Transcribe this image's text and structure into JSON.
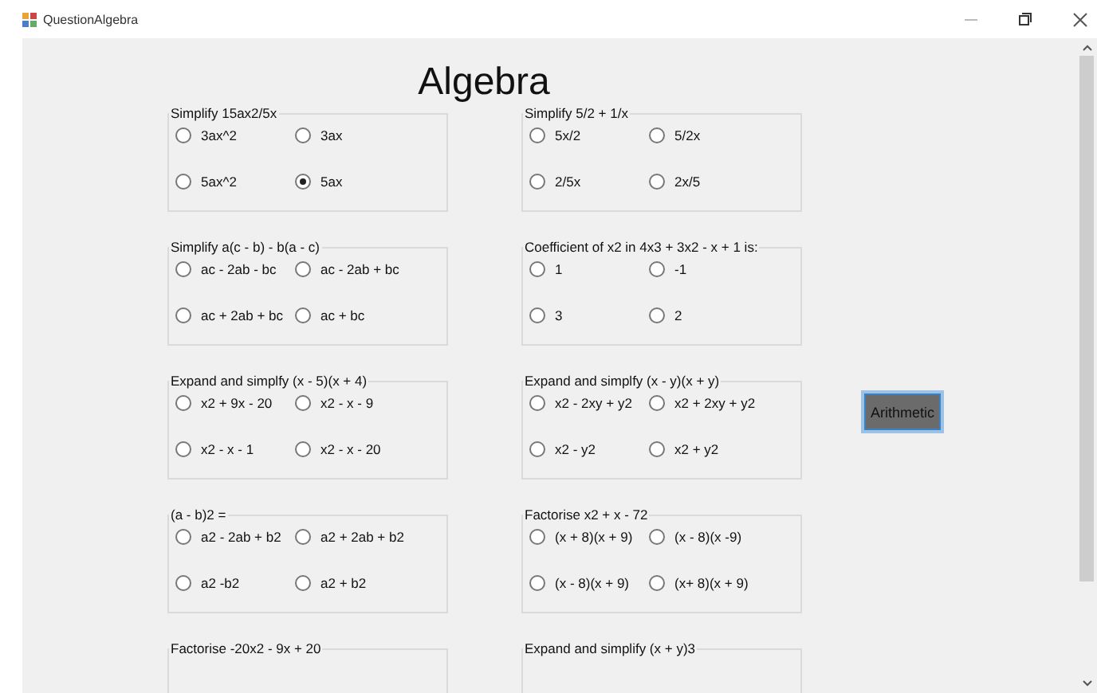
{
  "window": {
    "title": "QuestionAlgebra"
  },
  "heading": "Algebra",
  "questions": [
    {
      "prompt": "Simplify 15ax2/5x",
      "options": [
        {
          "label": "3ax^2",
          "selected": false
        },
        {
          "label": "3ax",
          "selected": false
        },
        {
          "label": "5ax^2",
          "selected": false
        },
        {
          "label": "5ax",
          "selected": true
        }
      ]
    },
    {
      "prompt": "Simplify 5/2 + 1/x",
      "options": [
        {
          "label": "5x/2",
          "selected": false
        },
        {
          "label": "5/2x",
          "selected": false
        },
        {
          "label": "2/5x",
          "selected": false
        },
        {
          "label": "2x/5",
          "selected": false
        }
      ]
    },
    {
      "prompt": "Simplify a(c - b) - b(a - c)",
      "options": [
        {
          "label": "ac - 2ab - bc",
          "selected": false
        },
        {
          "label": "ac - 2ab + bc",
          "selected": false
        },
        {
          "label": "ac + 2ab + bc",
          "selected": false
        },
        {
          "label": "ac + bc",
          "selected": false
        }
      ]
    },
    {
      "prompt": "Coefficient of x2 in 4x3 + 3x2 - x + 1 is:",
      "options": [
        {
          "label": "1",
          "selected": false
        },
        {
          "label": "-1",
          "selected": false
        },
        {
          "label": "3",
          "selected": false
        },
        {
          "label": "2",
          "selected": false
        }
      ]
    },
    {
      "prompt": "Expand and simplfy (x - 5)(x + 4)",
      "options": [
        {
          "label": "x2 + 9x - 20",
          "selected": false
        },
        {
          "label": "x2 - x - 9",
          "selected": false
        },
        {
          "label": "x2 - x - 1",
          "selected": false
        },
        {
          "label": "x2 - x - 20",
          "selected": false
        }
      ]
    },
    {
      "prompt": "Expand and simplfy (x - y)(x + y)",
      "options": [
        {
          "label": "x2 - 2xy + y2",
          "selected": false
        },
        {
          "label": "x2 + 2xy + y2",
          "selected": false
        },
        {
          "label": "x2 - y2",
          "selected": false
        },
        {
          "label": "x2 + y2",
          "selected": false
        }
      ]
    },
    {
      "prompt": "(a - b)2 =",
      "options": [
        {
          "label": "a2 - 2ab + b2",
          "selected": false
        },
        {
          "label": "a2 + 2ab + b2",
          "selected": false
        },
        {
          "label": "a2 -b2",
          "selected": false
        },
        {
          "label": "a2 + b2",
          "selected": false
        }
      ]
    },
    {
      "prompt": "Factorise x2 + x - 72",
      "options": [
        {
          "label": "(x + 8)(x + 9)",
          "selected": false
        },
        {
          "label": "(x - 8)(x -9)",
          "selected": false
        },
        {
          "label": "(x - 8)(x + 9)",
          "selected": false
        },
        {
          "label": "(x+ 8)(x + 9)",
          "selected": false
        }
      ]
    },
    {
      "prompt": "Factorise -20x2 - 9x + 20"
    },
    {
      "prompt": "Expand and simplify (x + y)3"
    }
  ],
  "button": "Arithmetic"
}
